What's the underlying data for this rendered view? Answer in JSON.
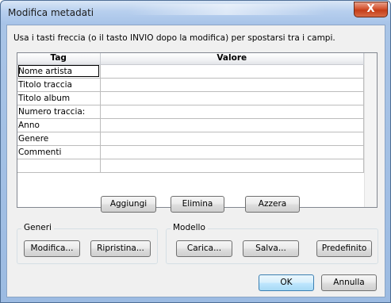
{
  "window": {
    "title": "Modifica metadati",
    "close_glyph": "X"
  },
  "instructions": "Usa i tasti freccia (o il tasto INVIO dopo la modifica) per spostarsi tra i campi.",
  "grid": {
    "headers": [
      "Tag",
      "Valore"
    ],
    "rows": [
      {
        "tag": "Nome artista",
        "value": ""
      },
      {
        "tag": "Titolo traccia",
        "value": ""
      },
      {
        "tag": "Titolo album",
        "value": ""
      },
      {
        "tag": "Numero traccia:",
        "value": ""
      },
      {
        "tag": "Anno",
        "value": ""
      },
      {
        "tag": "Genere",
        "value": ""
      },
      {
        "tag": "Commenti",
        "value": ""
      },
      {
        "tag": "",
        "value": ""
      }
    ]
  },
  "row_buttons": {
    "add": "Aggiungi",
    "delete": "Elimina",
    "clear": "Azzera"
  },
  "genres_group": {
    "label": "Generi",
    "edit": "Modifica...",
    "restore": "Ripristina..."
  },
  "template_group": {
    "label": "Modello",
    "load": "Carica...",
    "save": "Salva...",
    "default": "Predefinito"
  },
  "dialog_buttons": {
    "ok": "OK",
    "cancel": "Annulla"
  }
}
